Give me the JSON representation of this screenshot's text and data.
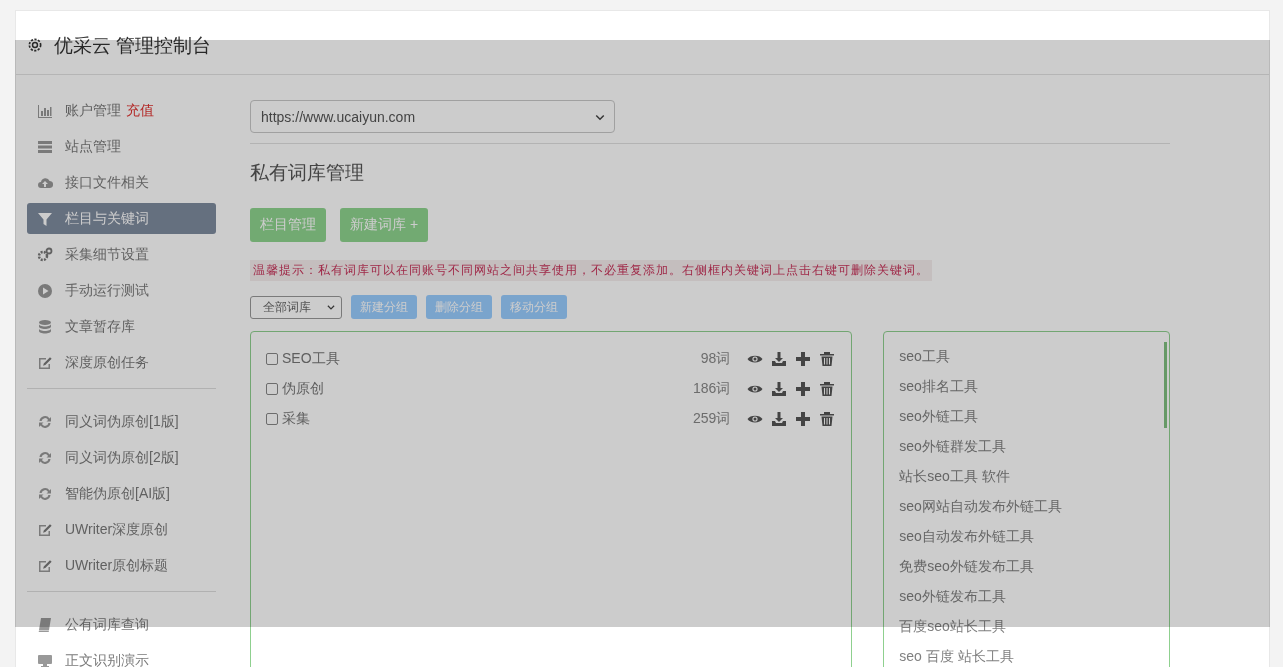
{
  "header": {
    "title": "优采云 管理控制台"
  },
  "sidebar": {
    "sections": [
      [
        {
          "label": "账户管理",
          "badge": "充值",
          "selected": false
        },
        {
          "label": "站点管理",
          "selected": false
        },
        {
          "label": "接口文件相关",
          "selected": false
        },
        {
          "label": "栏目与关键词",
          "selected": true
        },
        {
          "label": "采集细节设置",
          "selected": false
        },
        {
          "label": "手动运行测试",
          "selected": false
        },
        {
          "label": "文章暂存库",
          "selected": false
        },
        {
          "label": "深度原创任务",
          "selected": false
        }
      ],
      [
        {
          "label": "同义词伪原创[1版]",
          "selected": false
        },
        {
          "label": "同义词伪原创[2版]",
          "selected": false
        },
        {
          "label": "智能伪原创[AI版]",
          "selected": false
        },
        {
          "label": "UWriter深度原创",
          "selected": false
        },
        {
          "label": "UWriter原创标题",
          "selected": false
        }
      ],
      [
        {
          "label": "公有词库查询",
          "selected": false
        },
        {
          "label": "正文识别演示",
          "selected": false
        }
      ]
    ]
  },
  "site_select": {
    "value": "https://www.ucaiyun.com"
  },
  "page_title": "私有词库管理",
  "buttons": [
    "栏目管理",
    "新建词库 +"
  ],
  "tip": "温馨提示：私有词库可以在同账号不同网站之间共享使用，不必重复添加。右侧框内关键词上点击右键可删除关键词。",
  "group_select": {
    "value": "全部词库"
  },
  "group_buttons": [
    "新建分组",
    "删除分组",
    "移动分组"
  ],
  "libraries": [
    {
      "name": "SEO工具",
      "count": "98词",
      "checked": false
    },
    {
      "name": "伪原创",
      "count": "186词",
      "checked": false
    },
    {
      "name": "采集",
      "count": "259词",
      "checked": false
    }
  ],
  "keywords": [
    "seo工具",
    "seo排名工具",
    "seo外链工具",
    "seo外链群发工具",
    "站长seo工具 软件",
    "seo网站自动发布外链工具",
    "seo自动发布外链工具",
    "免费seo外链发布工具",
    "seo外链发布工具",
    "百度seo站长工具",
    "seo 百度 站长工具"
  ]
}
